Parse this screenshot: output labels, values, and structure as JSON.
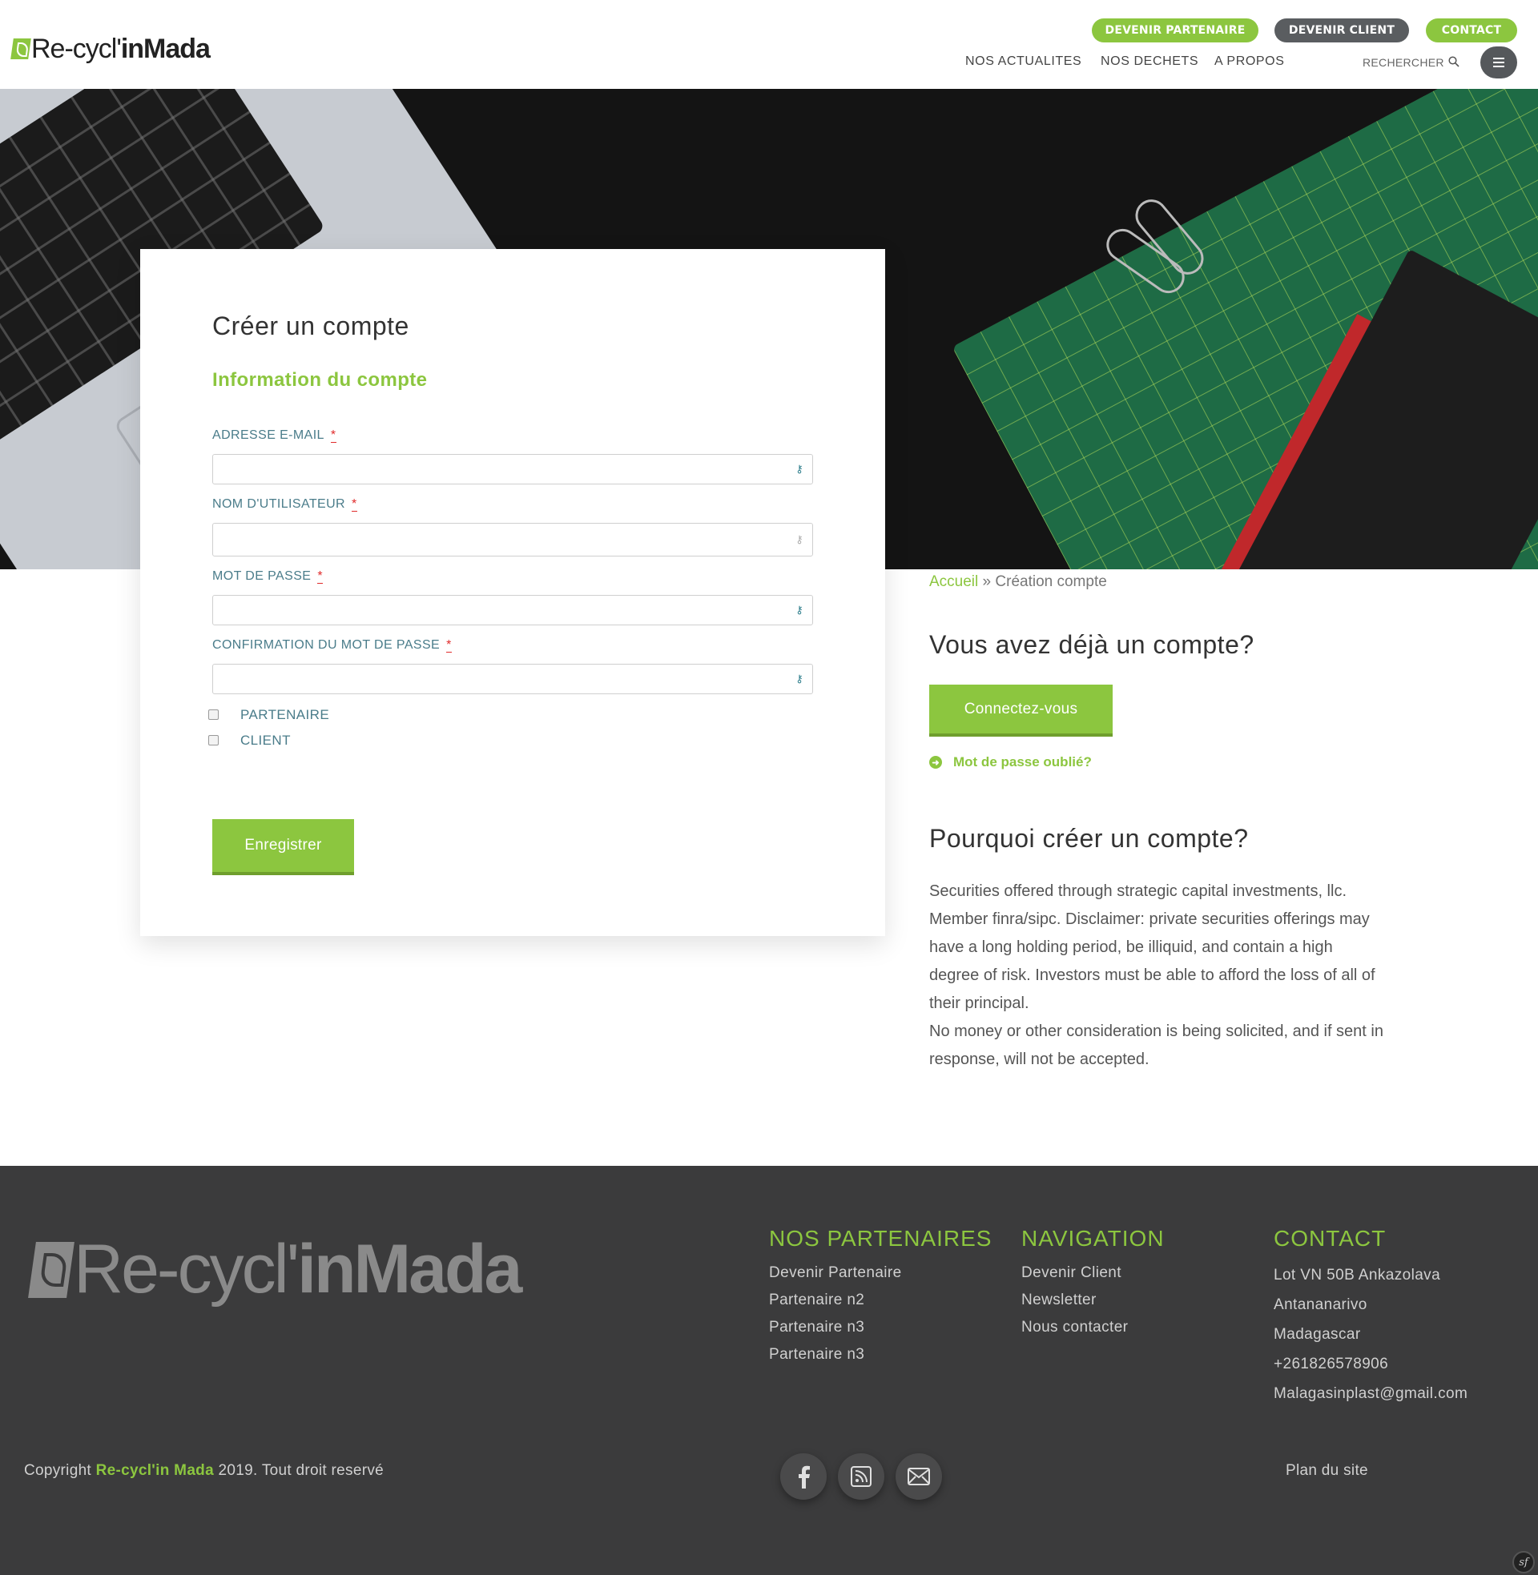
{
  "header": {
    "logo_a": "Re-cycl'",
    "logo_b": "inMada",
    "pills": [
      "DEVENIR PARTENAIRE",
      "DEVENIR CLIENT",
      "CONTACT"
    ],
    "nav": [
      "NOS ACTUALITES",
      "NOS DECHETS",
      "A PROPOS"
    ],
    "search_label": "RECHERCHER"
  },
  "form": {
    "title": "Créer un compte",
    "subtitle": "Information du compte",
    "fields": [
      {
        "label": "ADRESSE E-MAIL",
        "required": "*",
        "value": ""
      },
      {
        "label": "NOM D'UTILISATEUR",
        "required": "*",
        "value": ""
      },
      {
        "label": "MOT DE PASSE",
        "required": "*",
        "value": ""
      },
      {
        "label": "CONFIRMATION DU MOT DE PASSE",
        "required": "*",
        "value": ""
      }
    ],
    "checkboxes": [
      "PARTENAIRE",
      "CLIENT"
    ],
    "submit_label": "Enregistrer"
  },
  "breadcrumb": {
    "home": "Accueil",
    "sep": "»",
    "current": "Création compte"
  },
  "side": {
    "have_account_title": "Vous avez déjà un compte?",
    "login_label": "Connectez-vous",
    "forgot_label": "Mot de passe oublié?",
    "why_title": "Pourquoi créer un compte?",
    "why_text_1": "Securities offered through strategic capital investments, llc. Member finra/sipc. Disclaimer: private securities offerings may have a long holding period, be illiquid, and contain a high degree of risk. Investors must be able to afford the loss of all of their principal.",
    "why_text_2": "No money or other consideration is being solicited, and if sent in response, will not be accepted."
  },
  "footer": {
    "logo_a": "Re-cycl'",
    "logo_b": "inMada",
    "partners_title": "NOS PARTENAIRES",
    "partners": [
      "Devenir Partenaire",
      "Partenaire n2",
      "Partenaire n3",
      "Partenaire n3"
    ],
    "nav_title": "NAVIGATION",
    "nav": [
      "Devenir Client",
      "Newsletter",
      "Nous contacter"
    ],
    "contact_title": "CONTACT",
    "contact": [
      "Lot VN 50B Ankazolava",
      "Antananarivo",
      "Madagascar",
      "+261826578906",
      "Malagasinplast@gmail.com"
    ],
    "copyright_pre": "Copyright ",
    "copyright_brand": "Re-cycl'in Mada",
    "copyright_post": " 2019. Tout droit reservé",
    "sitemap": "Plan du site",
    "social_icons": [
      "facebook-icon",
      "rss-icon",
      "mail-icon"
    ]
  },
  "colors": {
    "accent": "#8cc63f",
    "dark": "#3b3b3c",
    "pill_grey": "#5a5d60"
  }
}
